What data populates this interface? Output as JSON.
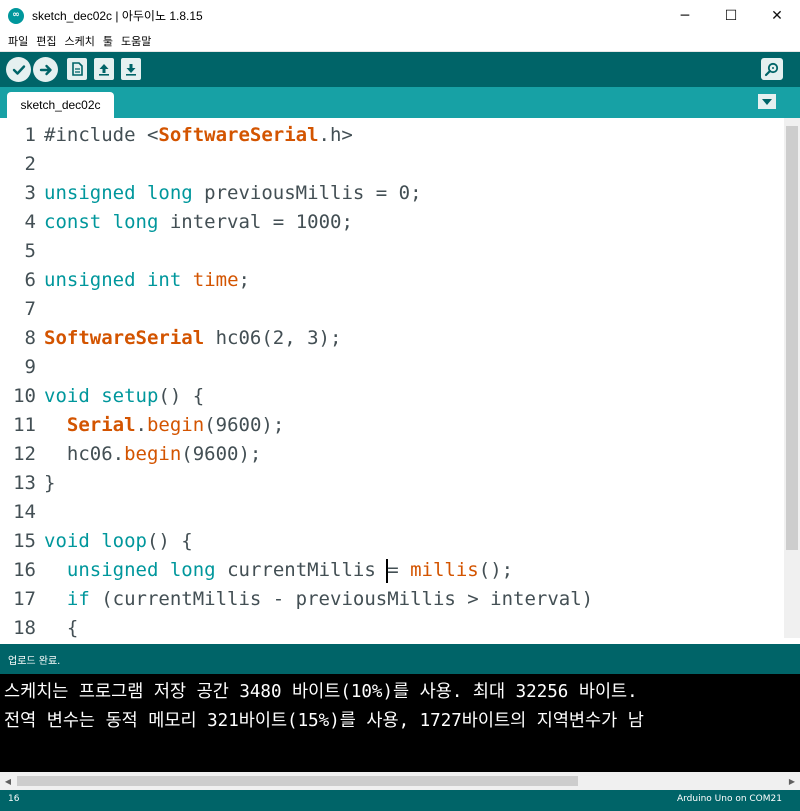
{
  "window": {
    "title": "sketch_dec02c | 아두이노 1.8.15",
    "app_icon": "arduino-logo-icon",
    "controls": {
      "minimize": "─",
      "maximize": "☐",
      "close": "✕"
    }
  },
  "menu": [
    "파일",
    "편집",
    "스케치",
    "툴",
    "도움말"
  ],
  "toolbar": {
    "buttons": [
      "verify-icon",
      "upload-icon",
      "new-icon",
      "open-icon",
      "save-icon"
    ],
    "serial_monitor": "serial-monitor-icon"
  },
  "tabs": {
    "active": "sketch_dec02c",
    "menu_icon": "tab-menu-icon"
  },
  "editor": {
    "lines": [
      {
        "n": "1",
        "html": "#include <<span class='hdr'>SoftwareSerial</span>.h>"
      },
      {
        "n": "2",
        "html": ""
      },
      {
        "n": "3",
        "html": "<span class='kw'>unsigned</span> <span class='kw'>long</span> previousMillis = 0;"
      },
      {
        "n": "4",
        "html": "<span class='kw'>const</span> <span class='kw'>long</span> interval = 1000;"
      },
      {
        "n": "5",
        "html": ""
      },
      {
        "n": "6",
        "html": "<span class='kw'>unsigned</span> <span class='kw'>int</span> <span class='fn'>time</span>;"
      },
      {
        "n": "7",
        "html": ""
      },
      {
        "n": "8",
        "html": "<span class='cls'>SoftwareSerial</span> hc06(2, 3);"
      },
      {
        "n": "9",
        "html": ""
      },
      {
        "n": "10",
        "html": "<span class='kw'>void</span> <span class='kw'>setup</span>() {"
      },
      {
        "n": "11",
        "html": "  <span class='cls'>Serial</span>.<span class='fn'>begin</span>(9600);"
      },
      {
        "n": "12",
        "html": "  hc06.<span class='fn'>begin</span>(9600);"
      },
      {
        "n": "13",
        "html": "}"
      },
      {
        "n": "14",
        "html": ""
      },
      {
        "n": "15",
        "html": "<span class='kw'>void</span> <span class='kw'>loop</span>() {"
      },
      {
        "n": "16",
        "html": "  <span class='kw'>unsigned</span> <span class='kw'>long</span> currentMillis <span class='caret'></span>= <span class='fn'>millis</span>();"
      },
      {
        "n": "17",
        "html": "  <span class='kw'>if</span> (currentMillis - previousMillis > interval)"
      },
      {
        "n": "18",
        "html": "  {"
      }
    ]
  },
  "status": {
    "message": "업로드 완료."
  },
  "console": {
    "lines": [
      "스케치는 프로그램 저장 공간 3480 바이트(10%)를 사용. 최대 32256 바이트.",
      "전역 변수는 동적 메모리 321바이트(15%)를 사용, 1727바이트의 지역변수가 남"
    ]
  },
  "footer": {
    "line_number": "16",
    "board": "Arduino Uno on COM21"
  }
}
